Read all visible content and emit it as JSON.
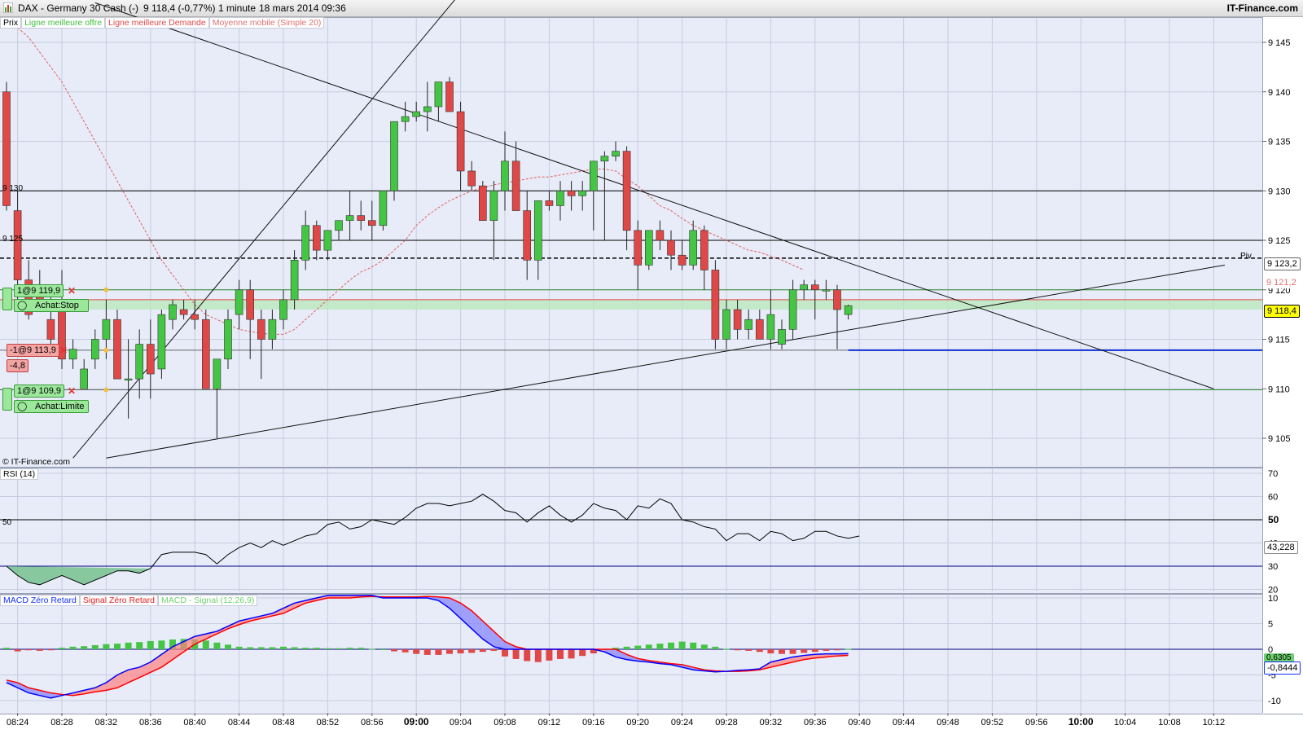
{
  "window": {
    "title": "DAX - Germany 30 Cash (-)",
    "quote": "9 118,4 (-0,77%)",
    "interval": "1 minute",
    "date_time": "18 mars 2014 09:36",
    "brand": "IT-Finance.com"
  },
  "legend": {
    "price": "Prix",
    "best_bid_line": "Ligne meilleure offre",
    "best_ask_line": "Ligne meilleure Demande",
    "moving_average": "Moyenne mobile (Simple 20)"
  },
  "watermark": "© IT-Finance.com",
  "orders": {
    "stop_qty": "1@9 119,9",
    "stop_label": "Achat:Stop",
    "sell_qty": "-1@9 113,9",
    "sell_pnl": "-4,8",
    "limit_qty": "1@9 109,9",
    "limit_label": "Achat:Limite"
  },
  "price_markers": {
    "pivot_label": "Piv",
    "pivot_value": "9 123,2",
    "upper_band": "9 121,2",
    "current": "9 118,4",
    "left_130": "9 130",
    "left_125": "9 125"
  },
  "rsi": {
    "title": "RSI (14)",
    "left_50": "50",
    "current": "43,228"
  },
  "macd": {
    "label_macd": "MACD Zéro Retard",
    "label_signal": "Signal Zéro Retard",
    "label_hist": "MACD - Signal (12,26,9)",
    "hist_value": "0,6305",
    "current": "-0,8444"
  },
  "colors": {
    "background": "#e7ecf8",
    "bull": "#44c544",
    "bear": "#e04848",
    "pivot_badge": "#ffff00",
    "macd_line": "#0000ff",
    "signal_line": "#ff0000"
  },
  "chart_data": [
    {
      "type": "candlestick",
      "interval": "1 minute",
      "y_ticks": [
        9105,
        9110,
        9115,
        9120,
        9125,
        9130,
        9135,
        9140,
        9145
      ],
      "ylim": [
        9103,
        9149
      ],
      "x_ticks": [
        "08:24",
        "08:28",
        "08:32",
        "08:36",
        "08:40",
        "08:44",
        "08:48",
        "08:52",
        "08:56",
        "09:00",
        "09:04",
        "09:08",
        "09:12",
        "09:16",
        "09:20",
        "09:24",
        "09:28",
        "09:32",
        "09:36",
        "09:40",
        "09:44",
        "09:48",
        "09:52",
        "09:56",
        "10:00",
        "10:04",
        "10:08",
        "10:12"
      ],
      "x_start": "08:23",
      "candles": [
        [
          9140,
          9141,
          9128,
          9128.5
        ],
        [
          9128,
          9130,
          9118,
          9121
        ],
        [
          9121,
          9123,
          9117,
          9117.5
        ],
        [
          9120,
          9122,
          9118,
          9119
        ],
        [
          9117,
          9120,
          9114,
          9115
        ],
        [
          9119,
          9122,
          9112,
          9113
        ],
        [
          9113,
          9115,
          9112,
          9114
        ],
        [
          9110,
          9113,
          9110,
          9112
        ],
        [
          9113,
          9116,
          9112,
          9115
        ],
        [
          9115,
          9119,
          9113,
          9117
        ],
        [
          9117,
          9118,
          9111,
          9111
        ],
        [
          9111,
          9115,
          9107,
          9111
        ],
        [
          9111,
          9116,
          9109,
          9114.5
        ],
        [
          9114.5,
          9117,
          9109,
          9111.5
        ],
        [
          9112,
          9118,
          9111,
          9117.5
        ],
        [
          9117,
          9119,
          9116,
          9118.5
        ],
        [
          9118,
          9119,
          9117,
          9117.5
        ],
        [
          9117.5,
          9119,
          9116,
          9117
        ],
        [
          9117,
          9118,
          9111,
          9110
        ],
        [
          9110,
          9113,
          9105,
          9113
        ],
        [
          9113,
          9118,
          9112,
          9117
        ],
        [
          9117.5,
          9121,
          9116,
          9120
        ],
        [
          9120,
          9121,
          9113,
          9117
        ],
        [
          9117,
          9118,
          9111,
          9115
        ],
        [
          9115,
          9118,
          9114,
          9117
        ],
        [
          9117,
          9120,
          9116,
          9119
        ],
        [
          9119,
          9124,
          9118,
          9123
        ],
        [
          9123,
          9128,
          9122,
          9126.5
        ],
        [
          9126.5,
          9127,
          9123,
          9124
        ],
        [
          9124,
          9126,
          9123,
          9126
        ],
        [
          9126,
          9127,
          9125,
          9127
        ],
        [
          9127,
          9130,
          9125,
          9127.5
        ],
        [
          9127.5,
          9129,
          9126,
          9127
        ],
        [
          9127,
          9129,
          9125,
          9126.5
        ],
        [
          9126.5,
          9130,
          9126,
          9130
        ],
        [
          9130,
          9137,
          9129,
          9137
        ],
        [
          9137,
          9139,
          9136,
          9137.5
        ],
        [
          9137.5,
          9139,
          9137,
          9138
        ],
        [
          9138,
          9141,
          9136,
          9138.5
        ],
        [
          9138.5,
          9141,
          9137,
          9141
        ],
        [
          9141,
          9141.5,
          9138,
          9138
        ],
        [
          9138,
          9139,
          9130,
          9132
        ],
        [
          9132,
          9133,
          9130,
          9130.5
        ],
        [
          9130.5,
          9131,
          9127,
          9127
        ],
        [
          9127,
          9131,
          9123,
          9130
        ],
        [
          9130,
          9136,
          9128,
          9133
        ],
        [
          9133,
          9135,
          9128,
          9128
        ],
        [
          9128,
          9130,
          9121,
          9123
        ],
        [
          9123,
          9129,
          9121,
          9129
        ],
        [
          9129,
          9130,
          9128,
          9128.5
        ],
        [
          9128.5,
          9131,
          9127,
          9130
        ],
        [
          9130,
          9131,
          9128,
          9129.5
        ],
        [
          9129.5,
          9131,
          9128,
          9130
        ],
        [
          9130,
          9133,
          9126,
          9133
        ],
        [
          9133,
          9134,
          9125,
          9133.5
        ],
        [
          9133.5,
          9135,
          9133,
          9134
        ],
        [
          9134,
          9134.5,
          9124,
          9126
        ],
        [
          9126,
          9127,
          9120,
          9122.5
        ],
        [
          9122.5,
          9126,
          9122,
          9126
        ],
        [
          9126,
          9127,
          9124,
          9125
        ],
        [
          9125,
          9126,
          9122,
          9123.5
        ],
        [
          9123.5,
          9125,
          9122,
          9122.5
        ],
        [
          9122.5,
          9127,
          9122,
          9126
        ],
        [
          9126,
          9126.5,
          9120,
          9122
        ],
        [
          9122,
          9123,
          9114,
          9115
        ],
        [
          9115,
          9119,
          9114,
          9118
        ],
        [
          9118,
          9119,
          9115,
          9116
        ],
        [
          9116,
          9118,
          9115,
          9117
        ],
        [
          9117,
          9118,
          9115,
          9115
        ],
        [
          9115,
          9120,
          9114,
          9117.5
        ],
        [
          9114.5,
          9117,
          9114,
          9116
        ],
        [
          9116,
          9121,
          9115,
          9120
        ],
        [
          9120,
          9121,
          9119,
          9120.5
        ],
        [
          9120.5,
          9121,
          9117,
          9120
        ],
        [
          9120,
          9121,
          9119,
          9120
        ],
        [
          9120,
          9120.5,
          9114,
          9118
        ],
        [
          9117.5,
          9118.5,
          9117,
          9118.4
        ]
      ],
      "moving_average_20": [
        [
          9147,
          9146.5,
          9145.5,
          9144,
          9142.5,
          9141,
          9139,
          9137,
          9135,
          9133,
          9131,
          9129,
          9127,
          9125,
          9123,
          9121.5,
          9120,
          9118.5,
          9117.5,
          9117,
          9116.5,
          9116,
          9115.8,
          9115.6,
          9115.5,
          9115.5,
          9116,
          9117,
          9118,
          9119,
          9120,
          9121,
          9121.8,
          9122.3,
          9123,
          9124,
          9125,
          9126.5,
          9127.5,
          9128.3,
          9129,
          9129.5,
          9130,
          9130.3,
          9130.6,
          9130.8,
          9131,
          9131.2,
          9131.4,
          9131.4,
          9131.6,
          9131.8,
          9132,
          9132.2,
          9132.2,
          9132,
          9131.2,
          9130.5,
          9129.5,
          9128.5,
          9128,
          9127.2,
          9126.5,
          9126,
          9125.5,
          9125,
          9124.5,
          9124,
          9123.8,
          9123.4,
          9123,
          9122.5,
          9122
        ]
      ],
      "horizontal_lines": {
        "resistance_9130": 9130,
        "resistance_9125": 9125,
        "pivot": 9123.2,
        "band_top": 9120,
        "band_upper": 9119,
        "band_lower": 9118,
        "order_sell": 9113.9,
        "order_limit": 9109.9
      },
      "trendlines": {
        "rising_steep": {
          "from": [
            "08:29",
            9103
          ],
          "to": [
            "09:04",
            9150
          ]
        },
        "falling": {
          "from": [
            "08:31",
            9149
          ],
          "to": [
            "10:12",
            9110
          ]
        },
        "rising_shallow": {
          "from": [
            "08:32",
            9103
          ],
          "to": [
            "10:13",
            9122.5
          ]
        }
      }
    },
    {
      "type": "line",
      "title": "RSI (14)",
      "y_ticks": [
        20,
        30,
        40,
        50,
        60,
        70
      ],
      "ylim": [
        18,
        74
      ],
      "level": 50,
      "oversold": 30,
      "values": [
        30,
        26,
        23,
        22,
        24,
        26,
        24,
        22,
        24,
        26,
        28,
        28,
        27,
        29,
        35,
        36,
        36,
        36,
        35,
        31,
        35,
        38,
        40,
        38,
        41,
        39,
        41,
        43,
        44,
        48,
        49,
        46,
        47,
        50,
        49,
        48,
        51,
        55,
        57,
        57,
        56,
        57,
        58,
        61,
        58,
        54,
        53,
        49,
        53,
        56,
        52,
        49,
        52,
        57,
        55,
        54,
        50,
        56,
        55,
        59,
        57,
        50,
        49,
        47,
        46,
        41,
        44,
        44,
        41,
        45,
        44,
        41,
        42,
        45,
        45,
        43,
        42,
        43
      ]
    },
    {
      "type": "line",
      "title": "MACD Zéro Retard",
      "y_ticks": [
        -10,
        -5,
        0,
        5,
        10
      ],
      "ylim": [
        -11,
        12
      ],
      "series": [
        {
          "name": "MACD Zéro Retard",
          "values": [
            -6.5,
            -7.5,
            -8.5,
            -9,
            -9.5,
            -9,
            -8.5,
            -8,
            -7.5,
            -6.5,
            -5,
            -4,
            -3.5,
            -2.5,
            -1,
            0.5,
            1.5,
            2.5,
            3,
            3.5,
            4.5,
            5.5,
            6,
            6.5,
            7,
            8,
            9,
            9.5,
            10,
            10.5,
            10.5,
            10.5,
            10.5,
            10.5,
            10,
            10,
            10,
            10,
            10,
            9.5,
            8,
            6,
            4,
            2,
            0.5,
            0,
            0,
            0,
            0,
            0,
            0,
            0,
            0,
            0,
            -0.5,
            -1.5,
            -2,
            -2.3,
            -2.5,
            -2.8,
            -3,
            -3.5,
            -4,
            -4.2,
            -4.4,
            -4.3,
            -4.1,
            -4,
            -3.8,
            -2.5,
            -2,
            -1.5,
            -1.2,
            -1.0,
            -0.9,
            -0.9,
            -0.85
          ]
        },
        {
          "name": "Signal Zéro Retard",
          "values": [
            -6,
            -6.5,
            -7.5,
            -8,
            -8.5,
            -8.8,
            -9,
            -8.7,
            -8.3,
            -8,
            -7.5,
            -6.5,
            -5.5,
            -4.5,
            -3.5,
            -2,
            -0.5,
            1,
            2,
            3,
            4,
            4.8,
            5.5,
            6,
            6.5,
            7,
            8,
            9,
            9.5,
            10,
            10,
            10,
            10.2,
            10.3,
            10.2,
            10.2,
            10.2,
            10.2,
            10.3,
            10.2,
            10,
            9,
            7.5,
            5.5,
            3.5,
            1.5,
            0.5,
            0,
            0,
            0,
            0,
            0,
            0,
            0,
            0,
            0,
            -1,
            -1.8,
            -2.2,
            -2.5,
            -2.8,
            -3,
            -3.5,
            -4,
            -4.2,
            -4.3,
            -4.3,
            -4.2,
            -4,
            -3.5,
            -3,
            -2.5,
            -2,
            -1.7,
            -1.5,
            -1.3,
            -1.2
          ]
        },
        {
          "name": "MACD - Signal (12,26,9)",
          "values": [
            0.3,
            -0.4,
            -0.2,
            -0.3,
            -0.2,
            0.3,
            0.5,
            0.6,
            0.8,
            1.0,
            1.1,
            1.3,
            1.4,
            1.6,
            1.7,
            1.9,
            2.0,
            1.9,
            1.7,
            1.3,
            0.9,
            0.5,
            0.4,
            0.4,
            0.4,
            0.5,
            0.4,
            0.3,
            0.3,
            0.2,
            0.2,
            0.3,
            0.3,
            0.1,
            0,
            -0.4,
            -0.6,
            -0.9,
            -1.1,
            -1.1,
            -0.9,
            -0.8,
            -0.7,
            -0.5,
            -0.3,
            -1.4,
            -1.9,
            -2.3,
            -2.5,
            -2.2,
            -1.9,
            -1.8,
            -1.3,
            -0.8,
            -0.1,
            0.3,
            0.5,
            0.7,
            0.9,
            1.1,
            1.3,
            1.5,
            1.3,
            0.9,
            0.5,
            0.1,
            -0.2,
            -0.3,
            -0.5,
            -0.8,
            -0.9,
            -0.9,
            -0.7,
            -0.5,
            -0.3,
            -0.2,
            0.1
          ]
        }
      ]
    }
  ]
}
